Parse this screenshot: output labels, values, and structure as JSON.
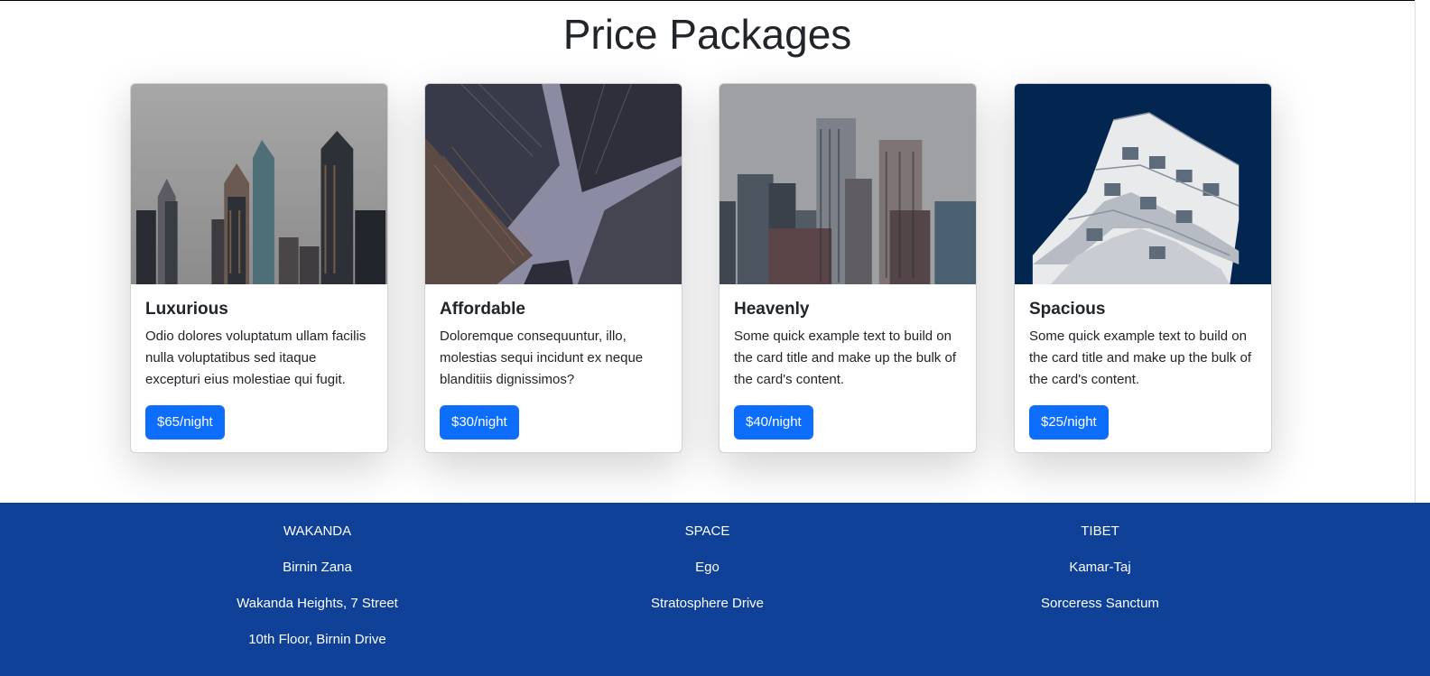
{
  "page": {
    "title": "Price Packages"
  },
  "cards": [
    {
      "image_name": "skyline-towers-image",
      "title": "Luxurious",
      "text": "Odio dolores voluptatum ullam facilis nulla voluptatibus sed itaque excepturi eius molestiae qui fugit.",
      "price": "$65/night"
    },
    {
      "image_name": "looking-up-buildings-image",
      "title": "Affordable",
      "text": "Doloremque consequuntur, illo, molestias sequi incidunt ex neque blanditiis dignissimos?",
      "price": "$30/night"
    },
    {
      "image_name": "city-skyline-image",
      "title": "Heavenly",
      "text": "Some quick example text to build on the card title and make up the bulk of the card's content.",
      "price": "$40/night"
    },
    {
      "image_name": "modern-building-image",
      "title": "Spacious",
      "text": "Some quick example text to build on the card title and make up the bulk of the card's content.",
      "price": "$25/night"
    }
  ],
  "footer": {
    "columns": [
      {
        "lines": [
          "WAKANDA",
          "Birnin Zana",
          "Wakanda Heights, 7 Street",
          "10th Floor, Birnin Drive"
        ]
      },
      {
        "lines": [
          "SPACE",
          "Ego",
          "Stratosphere Drive"
        ]
      },
      {
        "lines": [
          "TIBET",
          "Kamar-Taj",
          "Sorceress Sanctum"
        ]
      }
    ]
  },
  "colors": {
    "primary_button": "#0d6efd",
    "footer_background": "#0e4197"
  }
}
